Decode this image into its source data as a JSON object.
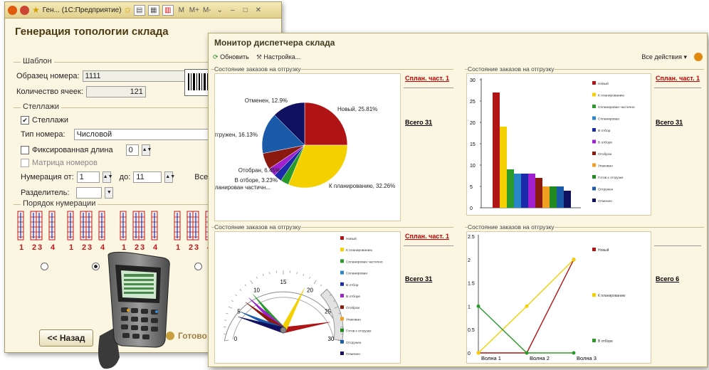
{
  "win1": {
    "titlebar_text": "Ген... (1С:Предприятие)",
    "title": "Генерация топологии склада",
    "template": {
      "group_title": "Шаблон",
      "sample_label": "Образец номера:",
      "sample_value": "1111",
      "cells_label": "Количество ячеек:",
      "cells_value": "121"
    },
    "racks": {
      "group_title": "Стеллажи",
      "racks_checkbox": "Стеллажи",
      "type_label": "Тип номера:",
      "type_value": "Числовой",
      "fixed_length": "Фиксированная длина",
      "fixed_length_value": "0",
      "matrix": "Матрица номеров",
      "num_from_label": "Нумерация от:",
      "num_from_value": "1",
      "num_to_label": "до:",
      "num_to_value": "11",
      "total_label": "Всего:",
      "separator_label": "Разделитель:"
    },
    "order": {
      "group_title": "Порядок нумерации",
      "labels": [
        "1",
        "2",
        "3",
        "4"
      ]
    },
    "buttons": {
      "back": "<< Назад",
      "done": "Готово"
    }
  },
  "win2": {
    "title": "Монитор диспетчера склада",
    "toolbar": {
      "refresh": "Обновить",
      "settings": "Настройка...",
      "all_actions": "Все действия ▾"
    },
    "colors": {
      "Новый": "#b01414",
      "К планированию": "#f4d000",
      "Спланирован частично": "#2a9a2a",
      "Спланирован": "#2a86c8",
      "В отбор": "#1a2aa8",
      "В отборе": "#a020d0",
      "Отобран": "#8a1a10",
      "Упакован": "#f0a020",
      "Готов к отгрузке": "#208a20",
      "Отгружен": "#1a5aa8",
      "Отменен": "#101060"
    },
    "panels": {
      "pie": {
        "title": "Состояние заказов на отгрузку",
        "link": "Сплан. част. 1",
        "total": "Всего 31",
        "slice_labels": [
          "Новый, 25.81%",
          "К планированию, 32.26%",
          "Спланирован частичн...",
          "В отборе, 3.23%",
          "Отобран, 6.45%",
          "Отгружен, 16.13%",
          "Отменен, 12.9%"
        ]
      },
      "bar": {
        "title": "Состояние заказов на отгрузку",
        "link": "Сплан. част. 1",
        "total": "Всего 31",
        "legend": [
          "Новый",
          "К планированию",
          "Спланирован частично",
          "Спланирован",
          "В отбор",
          "В отборе",
          "Отобран",
          "Упакован",
          "Готов к отгрузке",
          "Отгружен",
          "Отменен"
        ]
      },
      "gauge": {
        "title": "Состояние заказов на отгрузку",
        "link": "Сплан. част. 1",
        "total": "Всего 31",
        "ticks": [
          "0",
          "5",
          "10",
          "15",
          "20",
          "25",
          "30"
        ],
        "legend": [
          "Новый",
          "К планированию",
          "Спланирован частично",
          "Спланирован",
          "В отбор",
          "В отборе",
          "Отобран",
          "Упакован",
          "Готов к отгрузке",
          "Отгружен",
          "Отменен"
        ]
      },
      "line": {
        "title": "Состояние заказов на отгрузку",
        "total": "Всего 6",
        "legend": [
          "Новый",
          "К планированию",
          "В отборе"
        ]
      }
    }
  },
  "chart_data": [
    {
      "type": "pie",
      "title": "Состояние заказов на отгрузку",
      "series": [
        {
          "name": "Новый",
          "value": 25.81
        },
        {
          "name": "К планированию",
          "value": 32.26
        },
        {
          "name": "Спланирован частично",
          "value": 3.23
        },
        {
          "name": "В отбор",
          "value": 3.23
        },
        {
          "name": "В отборе",
          "value": 3.23
        },
        {
          "name": "Отобран",
          "value": 6.45
        },
        {
          "name": "Отгружен",
          "value": 16.13
        },
        {
          "name": "Отменен",
          "value": 12.9
        }
      ]
    },
    {
      "type": "bar",
      "title": "Состояние заказов на отгрузку",
      "categories": [
        "Новый",
        "К планированию",
        "Спланирован частично",
        "Спланирован",
        "В отбор",
        "В отборе",
        "Отобран",
        "Упакован",
        "Готов к отгрузке",
        "Отгружен",
        "Отменен"
      ],
      "values": [
        27,
        19,
        9,
        8,
        8,
        8,
        7,
        5,
        5,
        5,
        4
      ],
      "ylim": [
        0,
        30
      ],
      "yticks": [
        "0",
        "5",
        "10",
        "15",
        "20",
        "25",
        "30"
      ]
    },
    {
      "type": "gauge",
      "title": "Состояние заказов на отгрузку",
      "range": [
        0,
        30
      ],
      "series": [
        {
          "name": "Новый",
          "value": 27
        },
        {
          "name": "К планированию",
          "value": 19
        },
        {
          "name": "Спланирован частично",
          "value": 9
        },
        {
          "name": "Спланирован",
          "value": 8
        },
        {
          "name": "В отбор",
          "value": 8
        },
        {
          "name": "В отборе",
          "value": 8
        },
        {
          "name": "Отобран",
          "value": 7
        },
        {
          "name": "Отгружен",
          "value": 5
        },
        {
          "name": "Отменен",
          "value": 4
        }
      ]
    },
    {
      "type": "line",
      "title": "Состояние заказов на отгрузку",
      "categories": [
        "Волна 1",
        "Волна 2",
        "Волна 3"
      ],
      "ylim": [
        0,
        2.5
      ],
      "yticks": [
        "0",
        "0.5",
        "1",
        "1.5",
        "2",
        "2.5"
      ],
      "series": [
        {
          "name": "Новый",
          "values": [
            0,
            0,
            2
          ]
        },
        {
          "name": "К планированию",
          "values": [
            0,
            1,
            2
          ]
        },
        {
          "name": "В отборе",
          "values": [
            1,
            0,
            0
          ]
        }
      ]
    }
  ]
}
